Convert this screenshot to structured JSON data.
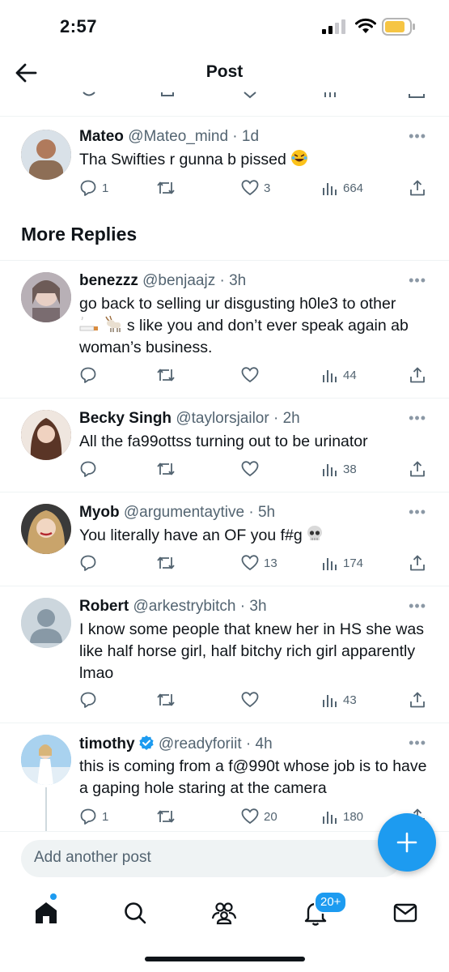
{
  "status_bar": {
    "time": "2:57"
  },
  "nav": {
    "title": "Post"
  },
  "section_title": "More Replies",
  "compose": {
    "placeholder": "Add another post"
  },
  "notifications_badge": "20+",
  "colors": {
    "accent": "#1d9bf0",
    "text": "#0f1419",
    "secondary": "#536471",
    "divider": "#eff3f4"
  },
  "posts": [
    {
      "name": "Mateo",
      "handle": "@Mateo_mind",
      "time": "1d",
      "text": "Tha Swifties r gunna b pissed",
      "emoji": "laughing-face",
      "replies": "1",
      "reposts": "",
      "likes": "3",
      "views": "664",
      "avatar_color": "#8d6e56"
    },
    {
      "name": "benezzz",
      "handle": "@benjaajz",
      "time": "3h",
      "text_a": "go back to selling ur disgusting h0le3 to other",
      "text_b": "s like you and don’t ever speak again ab",
      "text_c": "woman’s business.",
      "emoji": "cigarette-goat",
      "replies": "",
      "reposts": "",
      "likes": "",
      "views": "44",
      "avatar_color": "#9a8f93"
    },
    {
      "name": "Becky Singh",
      "handle": "@taylorsjailor",
      "time": "2h",
      "text": "All the fa99ottss turning out to be urinator",
      "replies": "",
      "reposts": "",
      "likes": "",
      "views": "38",
      "avatar_color": "#6b4a3c"
    },
    {
      "name": "Myob",
      "handle": "@argumentaytive",
      "time": "5h",
      "text": "You literally have an OF you f#g",
      "emoji": "skull",
      "replies": "",
      "reposts": "",
      "likes": "13",
      "views": "174",
      "avatar_color": "#c7a27a"
    },
    {
      "name": "Robert",
      "handle": "@arkestrybitch",
      "time": "3h",
      "text": "I know some people that knew her in HS she was like half horse girl, half bitchy rich girl apparently lmao",
      "replies": "",
      "reposts": "",
      "likes": "",
      "views": "43",
      "avatar_color": "#ccd6dd"
    },
    {
      "name": "timothy",
      "handle": "@readyforiit",
      "time": "4h",
      "text": "this is coming from a f@990t whose job is to have a gaping hole staring at the camera",
      "verified": true,
      "replies": "1",
      "reposts": "",
      "likes": "20",
      "views": "180",
      "avatar_color": "#8ec3e6"
    }
  ]
}
